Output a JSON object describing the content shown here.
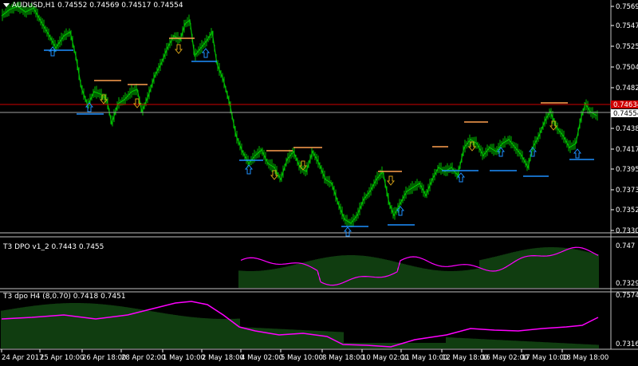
{
  "colors": {
    "background": "#000000",
    "candle": "#00c000",
    "grid": "#ffffff",
    "panel_separator": "#c0c0c0",
    "resistance_level": "#ff9f4f",
    "support_level": "#1e90ff",
    "down_arrow": "#d4a017",
    "up_arrow": "#1e90ff",
    "red_line": "#d00000",
    "gray_line": "#a0a0a0",
    "indicator_line": "#ff00ff",
    "histogram": "#1f7a1f",
    "price_box_red": "#d00000",
    "price_box_gray": "#ffffff"
  },
  "main_panel": {
    "title": "AUDUSD,H1  0.74552 0.74569 0.74517 0.74554",
    "icon": "dropdown-triangle-icon",
    "price_labels": [
      "0.75693",
      "0.75476",
      "0.75258",
      "0.75041",
      "0.74820",
      "0.74388",
      "0.74170",
      "0.73958",
      "0.73737",
      "0.73520",
      "0.73303"
    ],
    "red_price": "0.74634",
    "gray_price": "0.74554"
  },
  "indicator1": {
    "title": "T3 DPO v1_2 0.7443 0.7455",
    "price_labels": [
      "0.747",
      "0.7329"
    ]
  },
  "indicator2": {
    "title": "T3 dpo H4 (8,0.70) 0.7418 0.7451",
    "price_labels": [
      "0.7574",
      "0.7316"
    ]
  },
  "time_axis": [
    "24 Apr 2017",
    "25 Apr 10:00",
    "26 Apr 18:00",
    "28 Apr 02:00",
    "1 May 10:00",
    "2 May 18:00",
    "4 May 02:00",
    "5 May 10:00",
    "8 May 18:00",
    "10 May 02:00",
    "11 May 10:00",
    "12 May 18:00",
    "16 May 02:00",
    "17 May 10:00",
    "18 May 18:00"
  ]
}
